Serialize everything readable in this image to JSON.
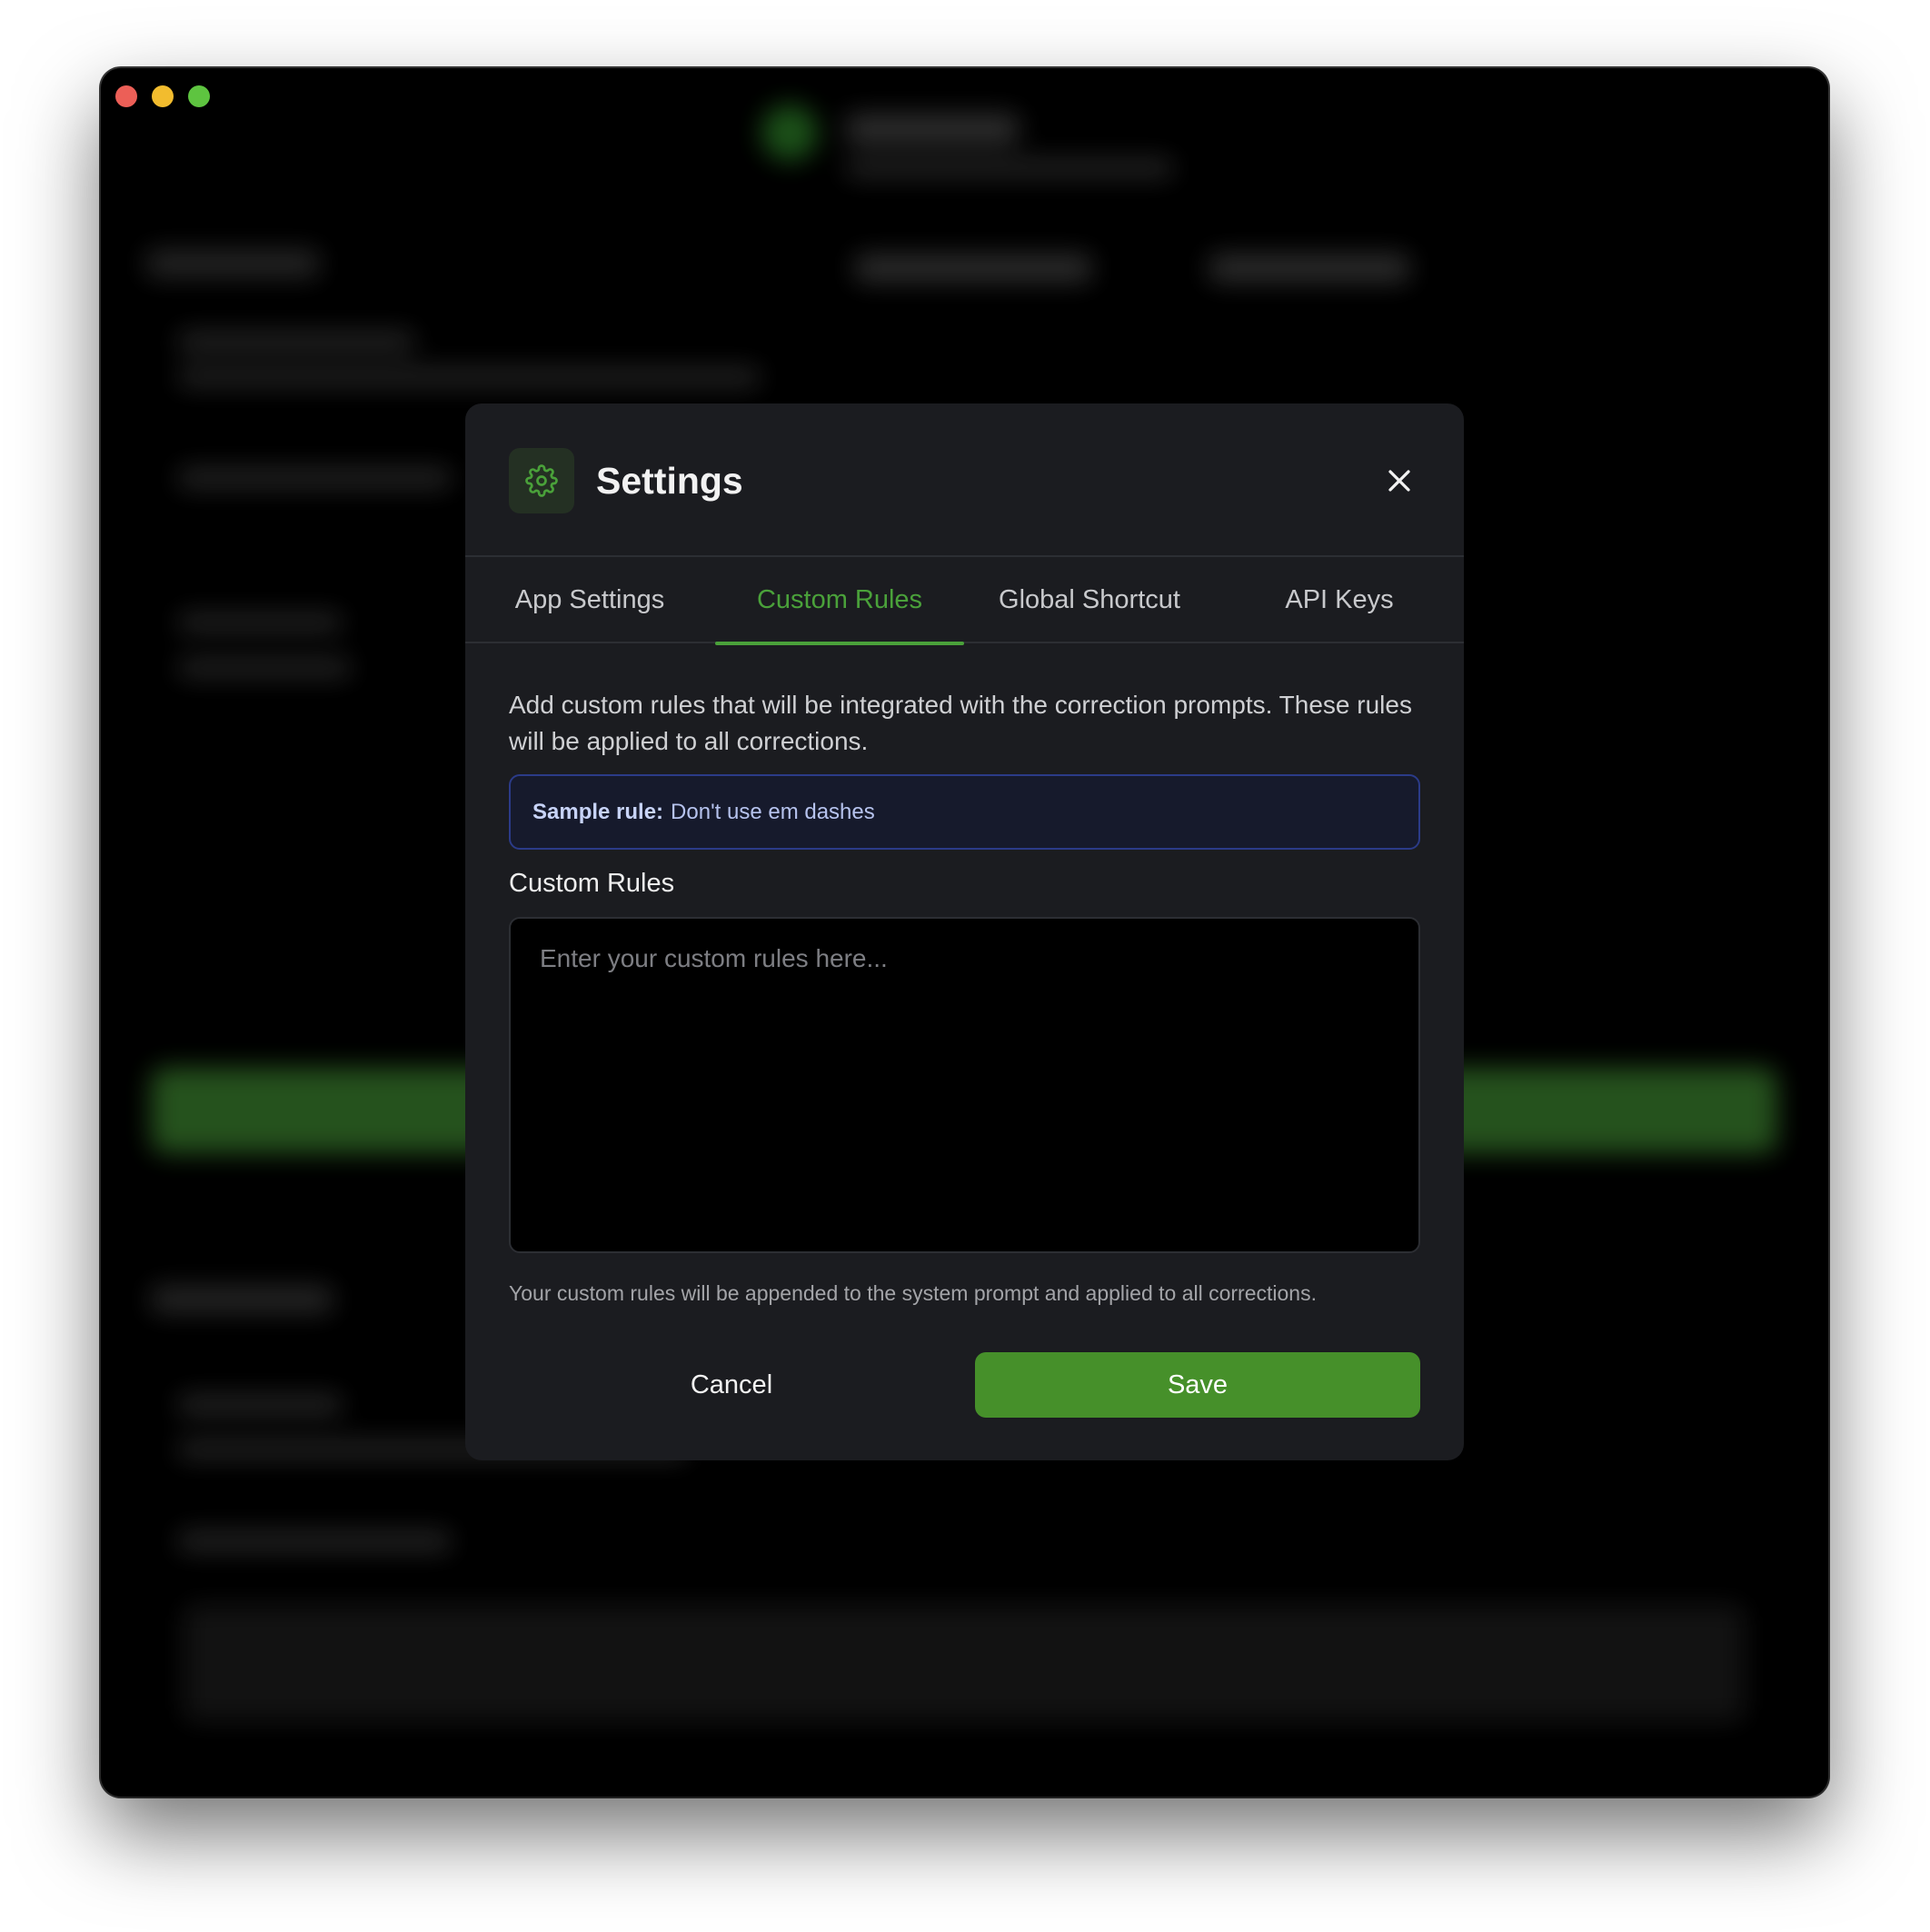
{
  "window": {
    "controls": [
      "close",
      "minimize",
      "maximize"
    ]
  },
  "modal": {
    "title": "Settings",
    "icon": "gear-icon",
    "accent_color": "#4aa13a",
    "tabs": [
      {
        "label": "App Settings",
        "active": false
      },
      {
        "label": "Custom Rules",
        "active": true
      },
      {
        "label": "Global Shortcut",
        "active": false
      },
      {
        "label": "API Keys",
        "active": false
      }
    ],
    "description": "Add custom rules that will be integrated with the correction prompts. These rules will be applied to all corrections.",
    "sample": {
      "label": "Sample rule:",
      "text": "Don't use em dashes"
    },
    "field_label": "Custom Rules",
    "input": {
      "value": "",
      "placeholder": "Enter your custom rules here..."
    },
    "help_text": "Your custom rules will be appended to the system prompt and applied to all corrections.",
    "cancel_label": "Cancel",
    "save_label": "Save",
    "save_color": "#46902a"
  }
}
